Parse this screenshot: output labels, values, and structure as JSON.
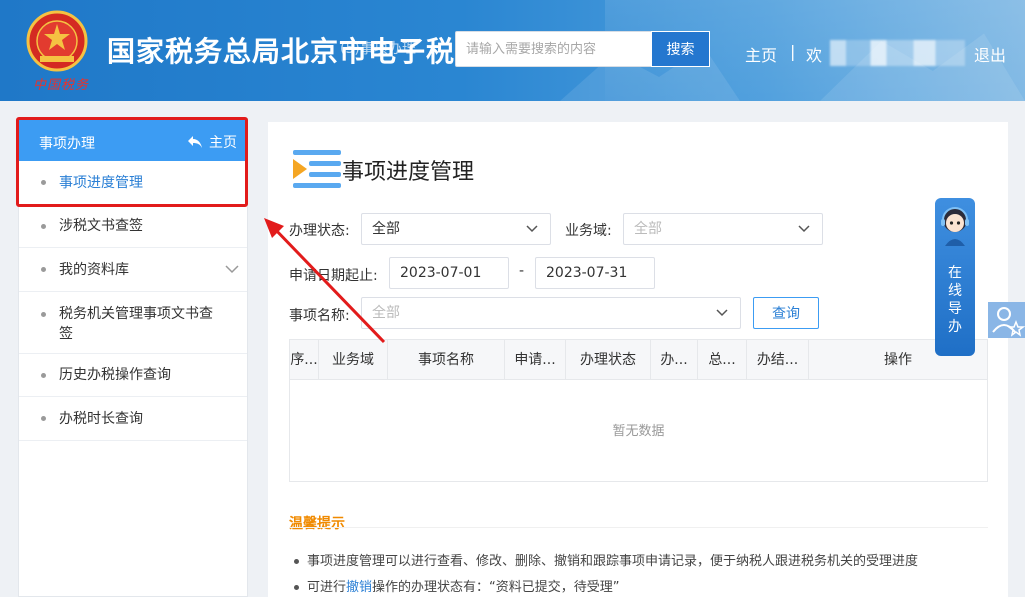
{
  "header": {
    "logo_text": "中国税务",
    "site_title": "国家税务总局北京市电子税",
    "title_overlay": "(5)事项办理",
    "search_placeholder": "请输入需要搜索的内容",
    "search_button": "搜索",
    "nav_home": "主页",
    "nav_sep": "|",
    "nav_welcome": "欢",
    "nav_logout": "退出"
  },
  "sidebar": {
    "header_title": "事项办理",
    "header_home": "主页",
    "items": [
      {
        "label": "事项进度管理",
        "active": true
      },
      {
        "label": "涉税文书查签"
      },
      {
        "label": "我的资料库",
        "has_submenu": true
      },
      {
        "label": "税务机关管理事项文书查签"
      },
      {
        "label": "历史办税操作查询"
      },
      {
        "label": "办税时长查询"
      }
    ]
  },
  "main": {
    "page_title": "事项进度管理",
    "filters": {
      "status_label": "办理状态:",
      "status_value": "全部",
      "domain_label": "业务域:",
      "domain_placeholder": "全部",
      "date_label": "申请日期起止:",
      "date_start": "2023-07-01",
      "date_sep": "-",
      "date_end": "2023-07-31",
      "item_label": "事项名称:",
      "item_placeholder": "全部",
      "query_button": "查询"
    },
    "table": {
      "columns": [
        "序...",
        "业务域",
        "事项名称",
        "申请...",
        "办理状态",
        "办...",
        "总...",
        "办结...",
        "操作"
      ],
      "empty_text": "暂无数据"
    },
    "tips": {
      "title": "温馨提示",
      "line1": "事项进度管理可以进行查看、修改、删除、撤销和跟踪事项申请记录，便于纳税人跟进税务机关的受理进度",
      "line2_prefix": "可进行",
      "line2_link": "撤销",
      "line2_suffix": "操作的办理状态有：“资料已提交，待受理”"
    }
  },
  "guide": {
    "text": [
      "在",
      "线",
      "导",
      "办"
    ]
  },
  "colors": {
    "header_blue": "#2a86d2",
    "accent_blue": "#3c9cf3",
    "annotation_red": "#e21b1b",
    "tips_orange": "#f08a00"
  }
}
